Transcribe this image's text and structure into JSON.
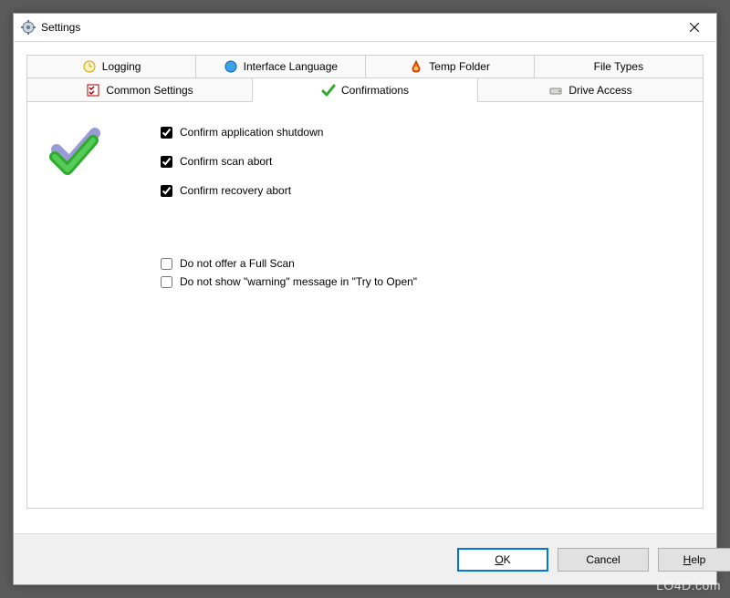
{
  "window": {
    "title": "Settings"
  },
  "tabs_row1": [
    {
      "label": "Logging",
      "icon": "clock-icon"
    },
    {
      "label": "Interface Language",
      "icon": "globe-icon"
    },
    {
      "label": "Temp Folder",
      "icon": "temp-icon"
    },
    {
      "label": "File Types",
      "icon": ""
    }
  ],
  "tabs_row2": [
    {
      "label": "Common Settings",
      "icon": "checklist-icon"
    },
    {
      "label": "Confirmations",
      "icon": "check-icon",
      "active": true
    },
    {
      "label": "Drive Access",
      "icon": "drive-icon"
    }
  ],
  "confirmations": {
    "opt1": {
      "label": "Confirm application shutdown",
      "checked": true
    },
    "opt2": {
      "label": "Confirm scan abort",
      "checked": true
    },
    "opt3": {
      "label": "Confirm recovery abort",
      "checked": true
    },
    "opt4": {
      "label": "Do not offer a Full Scan",
      "checked": false
    },
    "opt5": {
      "label": "Do not show \"warning\" message  in \"Try to Open\"",
      "checked": false
    }
  },
  "buttons": {
    "ok_pre": "",
    "ok_ul": "O",
    "ok_post": "K",
    "cancel": "Cancel",
    "help_pre": "",
    "help_ul": "H",
    "help_post": "elp"
  },
  "watermark": "LO4D.com"
}
